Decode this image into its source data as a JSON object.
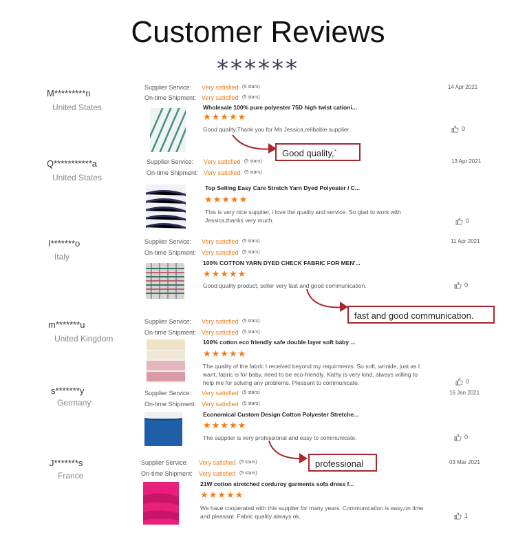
{
  "page": {
    "title": "Customer Reviews",
    "divider": "******"
  },
  "labels": {
    "supplier_service": "Supplier Service:",
    "ontime_shipment": "On-time Shipment:"
  },
  "reviews": [
    {
      "user": "M*********n",
      "country": "United States",
      "supplier_service": "Very satisfied",
      "supplier_stars": "(5 stars)",
      "ontime": "Very satisfied",
      "ontime_stars": "(5 stars)",
      "date": "14 Apr 2021",
      "product": "Wholesale 100% pure polyester 75D high twist cationi...",
      "rating": "★★★★★",
      "comment": "Good quality,Thank you for Ms Jessica,relibable supplier.",
      "likes": "0",
      "thumb": "teal-stripes"
    },
    {
      "user": "Q***********a",
      "country": "United States",
      "supplier_service": "Very satisfied",
      "supplier_stars": "(5 stars)",
      "ontime": "Very satisfied",
      "ontime_stars": "(5 stars)",
      "date": "13 Apr 2021",
      "product": "Top Selling Easy Care Stretch Yarn Dyed Polyester / C...",
      "rating": "★★★★★",
      "comment": "This is very nice supplier, i love the quality and service. So glad to work with Jessica,thanks very much.",
      "likes": "0",
      "thumb": "navy-stripes"
    },
    {
      "user": "I*******o",
      "country": "Italy",
      "supplier_service": "Very satisfied",
      "supplier_stars": "(5 stars)",
      "ontime": "Very satisfied",
      "ontime_stars": "(5 stars)",
      "date": "11 Apr 2021",
      "product": "100% COTTON YARN DYED CHECK FABRIC FOR MEN'...",
      "rating": "★★★★★",
      "comment": "Good quality product, seller very fast and good communication.",
      "likes": "0",
      "thumb": "check"
    },
    {
      "user": "m*******u",
      "country": "United Kingdom",
      "supplier_service": "Very satisfied",
      "supplier_stars": "(5 stars)",
      "ontime": "Very satisfied",
      "ontime_stars": "(5 stars)",
      "date": "",
      "product": "100% cotton eco friendly safe double layer soft baby ...",
      "rating": "★★★★★",
      "comment": "The quality of the fabric I received beyond my requirments. So soft, wrinkle, just as I want, fabric is for baby, need to be eco-friendly. Kathy is very kind, always willing to help me for solving any problems. Pleasant to communicate.",
      "likes": "0",
      "thumb": "pastel"
    },
    {
      "user": "s*******y",
      "country": "Germany",
      "supplier_service": "Very satisfied",
      "supplier_stars": "(5 stars)",
      "ontime": "Very satisfied",
      "ontime_stars": "(5 stars)",
      "date": "16 Jan 2021",
      "product": "Economical Custom Design Cotton Polyester Stretche...",
      "rating": "★★★★★",
      "comment": "The supplier is very professional and easy to communicate.",
      "likes": "0",
      "thumb": "blue"
    },
    {
      "user": "J*******s",
      "country": "France",
      "supplier_service": "Very satisfied",
      "supplier_stars": "(5 stars)",
      "ontime": "Very satisfied",
      "ontime_stars": "(5 stars)",
      "date": "03 Mar 2021",
      "product": "21W cotton stretched corduroy garments sofa dress f...",
      "rating": "★★★★★",
      "comment": "We have cooperated with this supplier for many years. Communication is easy,on time and pleasant. Fabric quality always ok.",
      "likes": "1",
      "thumb": "pink"
    }
  ],
  "callouts": [
    {
      "text": "Good quality,`"
    },
    {
      "text": "fast and good communication."
    },
    {
      "text": "professional"
    }
  ],
  "colors": {
    "accent": "#f07d16",
    "callout_border": "#a8262d",
    "text": "#555555"
  }
}
